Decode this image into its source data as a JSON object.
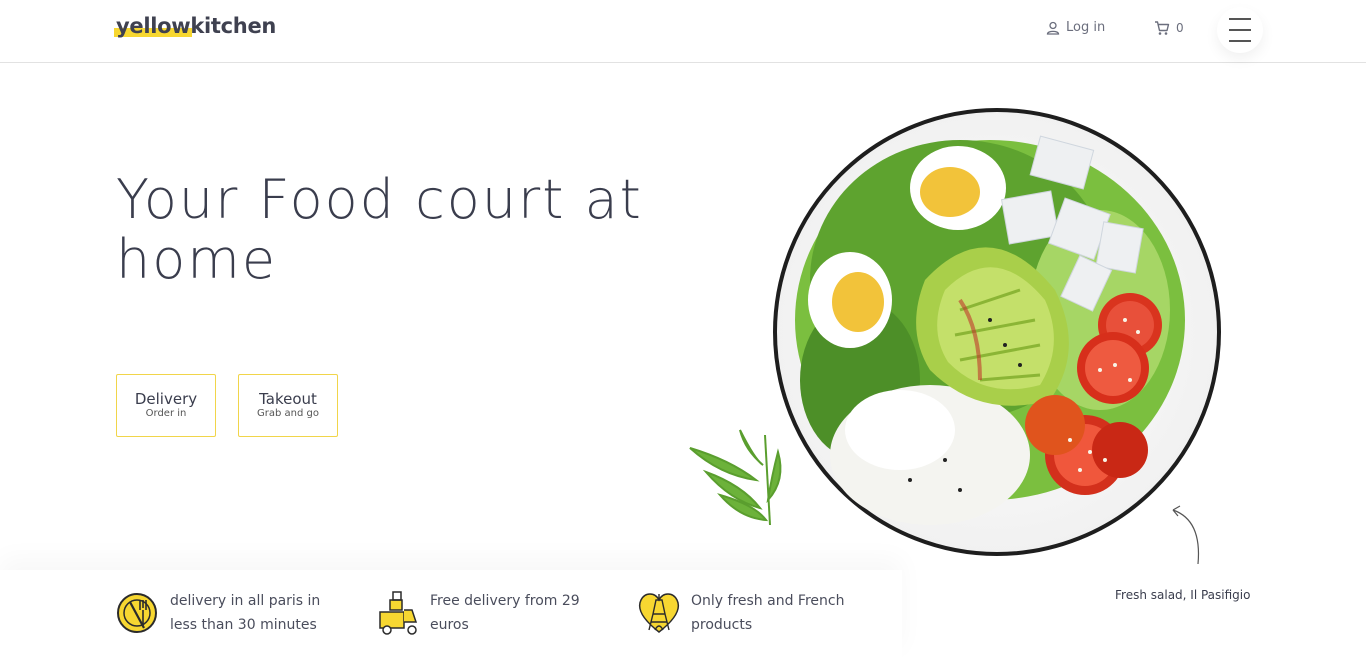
{
  "header": {
    "logo_highlight": "yellow",
    "logo_rest": "kitchen",
    "login_label": "Log in",
    "cart_count": "0"
  },
  "hero": {
    "title": "Your Food court at home",
    "buttons": [
      {
        "title": "Delivery",
        "subtitle": "Order in"
      },
      {
        "title": "Takeout",
        "subtitle": "Grab and go"
      }
    ],
    "image_caption": "Fresh salad, Il Pasifigio"
  },
  "features": [
    {
      "icon": "clock-fork-knife-icon",
      "text": "delivery in all paris in less than 30 minutes"
    },
    {
      "icon": "delivery-scooter-icon",
      "text": "Free delivery from 29 euros"
    },
    {
      "icon": "heart-eiffel-tower-icon",
      "text": "Only fresh and French products"
    }
  ],
  "colors": {
    "accent": "#f7d731",
    "text": "#3a3d4d",
    "border": "#f1d54a"
  }
}
